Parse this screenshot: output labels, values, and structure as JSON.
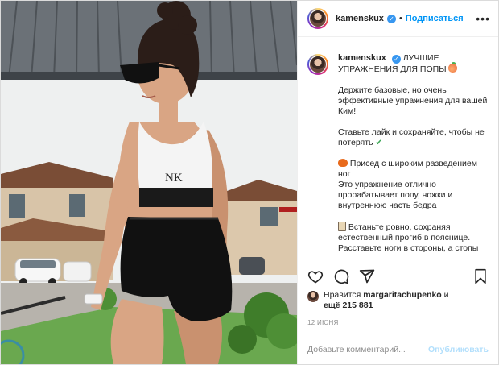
{
  "post": {
    "username": "kamenskux",
    "follow_label": "Подписаться",
    "separator": "•",
    "more_label": "•••"
  },
  "photo": {
    "shirt_print": "NK",
    "colors": {
      "sky": "#eef0f0",
      "roof": "#5a6066",
      "grass": "#6aa84f",
      "top": "#f4f4f4",
      "shorts": "#111111",
      "skin": "#d9a584",
      "hair": "#2b1d18"
    }
  },
  "caption": {
    "username": "kamenskux",
    "lines": [
      "ЛУЧШИЕ УПРАЖНЕНИЯ ДЛЯ ПОПЫ",
      "Держите базовые, но очень эффективные упражнения для вашей Ким!",
      "Ставьте лайк и сохраняйте, чтобы не потерять",
      "Присед с широким разведением ног",
      "Это упражнение отлично прорабатывает попу, ножки и внутреннюю часть бедра",
      "Встаньте ровно, сохраняя естественный прогиб в пояснице.",
      "Расставьте ноги в стороны, а стопы"
    ],
    "check_emoji": "✔"
  },
  "likes": {
    "prefix": "Нравится",
    "liker": "margaritachupenko",
    "middle": "и",
    "count": "ещё 215 881"
  },
  "date": "12 ИЮНЯ",
  "comment": {
    "placeholder": "Добавьте комментарий...",
    "publish_label": "Опубликовать"
  },
  "icons": [
    "heart-icon",
    "comment-icon",
    "share-icon",
    "bookmark-icon",
    "verified-icon",
    "more-icon"
  ]
}
